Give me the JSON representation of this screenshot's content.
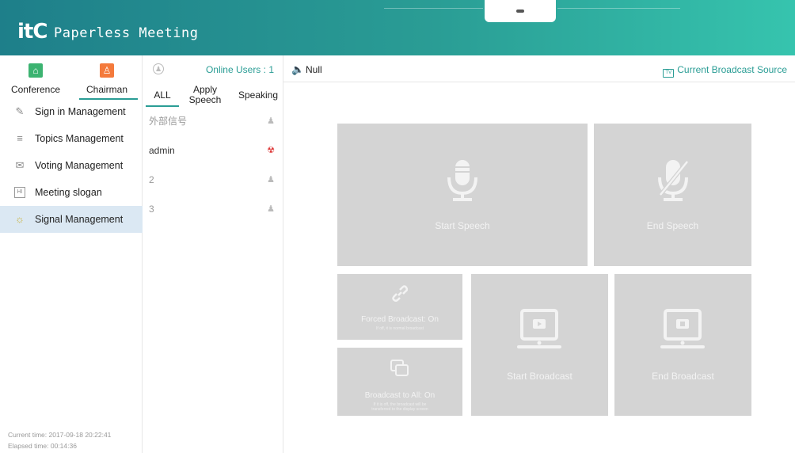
{
  "header": {
    "logo": "itC",
    "title": "Paperless Meeting"
  },
  "sidebar": {
    "roles": [
      {
        "label": "Conference",
        "icon": "home-icon"
      },
      {
        "label": "Chairman",
        "icon": "user-icon"
      }
    ],
    "items": [
      {
        "label": "Sign in Management",
        "icon": "edit-icon"
      },
      {
        "label": "Topics Management",
        "icon": "list-icon"
      },
      {
        "label": "Voting Management",
        "icon": "ballot-icon"
      },
      {
        "label": "Meeting slogan",
        "icon": "slogan-icon",
        "icon_text": "HI"
      },
      {
        "label": "Signal Management",
        "icon": "bulb-icon"
      }
    ],
    "active_item": "Signal Management",
    "current_time": "Current time: 2017-09-18 20:22:41",
    "elapsed_time": "Elapsed time: 00:14:36"
  },
  "users": {
    "online_label": "Online Users : 1",
    "tabs": [
      "ALL",
      "Apply Speech",
      "Speaking"
    ],
    "tab_apply_line1": "Apply",
    "tab_apply_line2": "Speech",
    "active_tab": "ALL",
    "list": [
      {
        "name": "外部信号",
        "icon": "user-icon"
      },
      {
        "name": "admin",
        "icon": "mic-muted-icon"
      },
      {
        "name": "2",
        "icon": "user-icon"
      },
      {
        "name": "3",
        "icon": "user-icon"
      }
    ]
  },
  "main": {
    "status": "Null",
    "broadcast_source": "Current Broadcast Source",
    "tv_badge": "TV",
    "tiles": {
      "start_speech": "Start Speech",
      "end_speech": "End Speech",
      "forced_broadcast": "Forced Broadcast: On",
      "forced_broadcast_sub": "If off, it is normal broadcast",
      "broadcast_all": "Broadcast to All: On",
      "broadcast_all_sub1": "If it is off, the broadcast will be",
      "broadcast_all_sub2": "transferred to the display screen",
      "start_broadcast": "Start Broadcast",
      "end_broadcast": "End Broadcast"
    }
  },
  "colors": {
    "accent": "#2a9d95",
    "header_start": "#1e7f8a",
    "header_end": "#36c4ae",
    "conference_icon": "#3cb371",
    "chairman_icon": "#f47a3c",
    "tile": "#d4d4d4",
    "active_menu": "#dbe8f3"
  }
}
